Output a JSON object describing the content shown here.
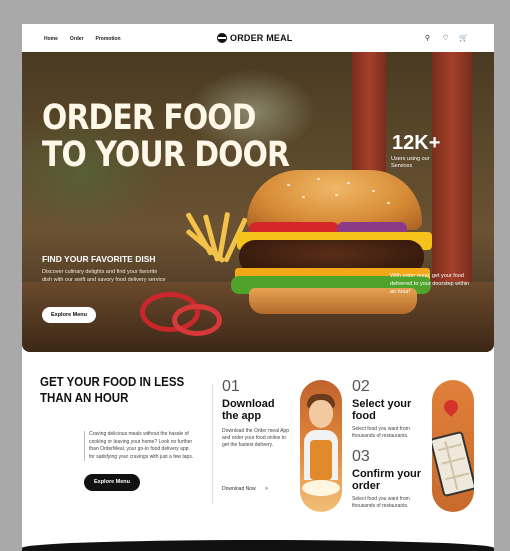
{
  "nav": {
    "links": [
      "Home",
      "Order",
      "Promotion"
    ],
    "logo_text": "ORDER MEAL",
    "icons": [
      "search-icon",
      "heart-icon",
      "cart-icon"
    ]
  },
  "hero": {
    "title_line1": "ORDER FOOD",
    "title_line2": "TO YOUR DOOR",
    "stat_number": "12K+",
    "stat_label": "Users using our Services",
    "favorite_title": "FIND YOUR FAVORITE DISH",
    "favorite_desc": "Discover culinary delights and find your favorite dish with our swift and savory food delivery service",
    "explore_label": "Explore Menu",
    "right_note": "With order meal, get your food delivered to your doorstep within an hour!"
  },
  "section2": {
    "title": "GET YOUR FOOD IN LESS THAN AN HOUR",
    "description": "Craving delicious meals without the hassle of cooking or leaving your home? Look no further than OrderMeal, your go-to food delivery app for satisfying your cravings with just a few taps.",
    "explore_label": "Explore Menu",
    "steps": [
      {
        "number": "01",
        "title": "Download the app",
        "desc": "Download the Order meal App and order your food online to get the fastest delivery."
      },
      {
        "number": "02",
        "title": "Select your food",
        "desc": "Select food you want from thousands of restaurants."
      },
      {
        "number": "03",
        "title": "Confirm your order",
        "desc": "Select food you want from thousands of restaurants."
      }
    ],
    "download_link": "Download Now",
    "download_arrow": ">"
  },
  "colors": {
    "accent": "#e58a3c",
    "dark": "#111111",
    "hero_text": "#fff8e8"
  }
}
